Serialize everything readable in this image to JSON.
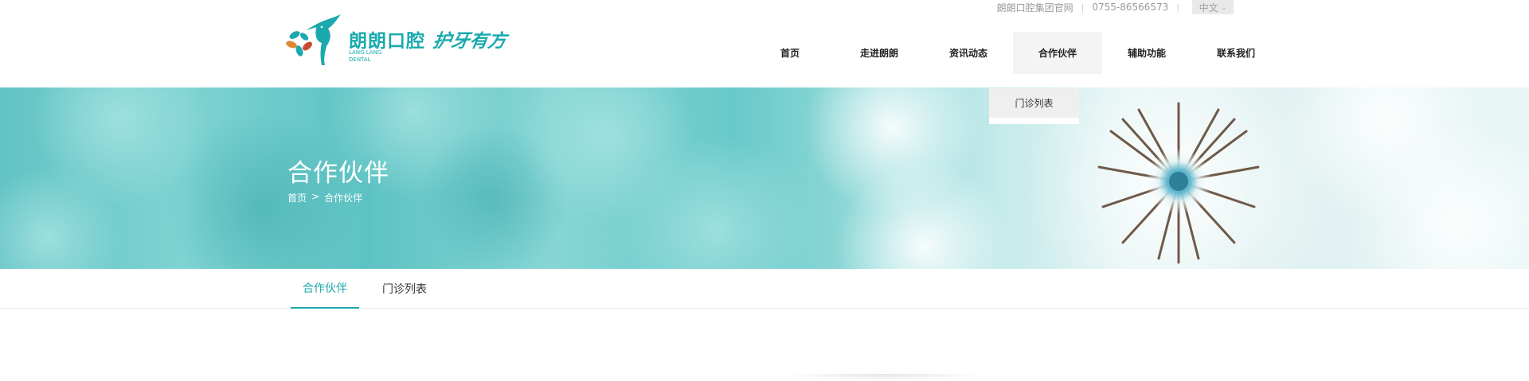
{
  "topbar": {
    "group_site": "朗朗口腔集团官网",
    "phone": "0755-86566573",
    "sep": "|",
    "language": "中文"
  },
  "logo": {
    "cn": "朗朗口腔",
    "en_line1": "LANG LANG",
    "en_line2": "DENTAL",
    "slogan": "护牙有方"
  },
  "nav": {
    "items": [
      {
        "label": "首页"
      },
      {
        "label": "走进朗朗"
      },
      {
        "label": "资讯动态"
      },
      {
        "label": "合作伙伴"
      },
      {
        "label": "辅助功能"
      },
      {
        "label": "联系我们"
      }
    ],
    "active_index": 3,
    "dropdown": {
      "items": [
        {
          "label": "门诊列表"
        }
      ]
    }
  },
  "banner": {
    "title": "合作伙伴",
    "breadcrumb": {
      "home": "首页",
      "separator": ">",
      "current": "合作伙伴"
    }
  },
  "subtabs": {
    "items": [
      {
        "label": "合作伙伴"
      },
      {
        "label": "门诊列表"
      }
    ],
    "active_index": 0
  },
  "colors": {
    "brand": "#1ba9ae",
    "banner_teal": "#63c3c4"
  }
}
